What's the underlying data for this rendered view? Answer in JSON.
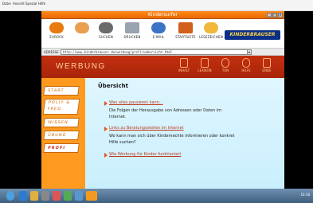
{
  "outer_menu": [
    "Datei",
    "Ansicht",
    "Spezial",
    "Hilfe"
  ],
  "window": {
    "title": "Kindersurfer"
  },
  "toolbar": {
    "buttons": [
      "ZURÜCK",
      "SUCHEN",
      "DRUCKEN",
      "E-MAIL",
      "STARTSEITE",
      "LESEZEICHEN"
    ],
    "brand": "KINDERBRAUSER"
  },
  "address": {
    "label": "ADRESSE",
    "value": "http://www.kinderbrauser.de/werbung/profi/uebersicht.html"
  },
  "section": {
    "title": "WERBUNG",
    "nav": [
      "INHALT",
      "LEXIKON",
      "TUN",
      "HILFE",
      "ENDE"
    ]
  },
  "sidebar": {
    "items": [
      "START",
      "POLLY & FRED",
      "WISSEN",
      "ÜBUNG",
      "PROFI"
    ],
    "active": "PROFI"
  },
  "content": {
    "heading": "Übersicht",
    "items": [
      {
        "link": "Was alles passieren kann...",
        "desc": "Die Folgen der Herausgabe von Adressen oder Daten im Internet."
      },
      {
        "link": "Links zu Beratungsstellen im Internet",
        "desc": "Wo kann man sich über Kindernechte informieren oder konkret Hilfe suchen?"
      },
      {
        "link": "Wie Werbung für Kinder funktioniert",
        "desc": ""
      }
    ]
  },
  "colors": {
    "accent": "#ff9a1f",
    "brand_bar": "#c2300f",
    "link": "#c0391d",
    "content_bg": "#dff6ff"
  },
  "taskbar": {
    "time": "16:38"
  }
}
